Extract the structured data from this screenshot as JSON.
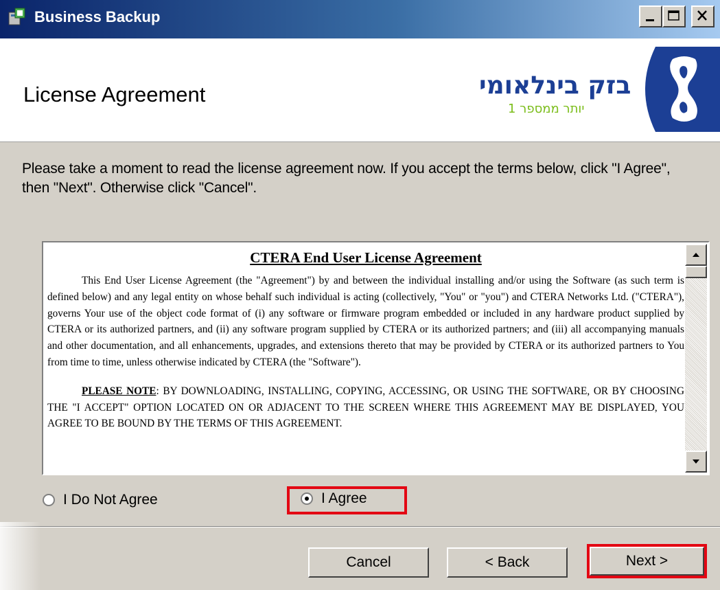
{
  "window": {
    "title": "Business Backup",
    "controls": {
      "minimize": "minimize",
      "maximize": "maximize",
      "close": "close"
    }
  },
  "header": {
    "title": "License Agreement",
    "logo_main": "בזק בינלאומי",
    "logo_sub": "יותר ממספר 1"
  },
  "intro": "Please take a moment to read the license agreement now. If you accept the terms below, click \"I Agree\", then \"Next\". Otherwise click \"Cancel\".",
  "license": {
    "title": "CTERA End User License Agreement",
    "para1": "This End User License Agreement (the \"Agreement\") by and between the individual installing and/or using the Software (as such term is defined below) and any legal entity on whose behalf such individual is acting (collectively, \"You\" or \"you\") and CTERA Networks Ltd. (\"CTERA\"), governs Your use of the object code format of (i) any software or firmware program embedded or included in any hardware product supplied by CTERA or its authorized partners, and (ii) any software program supplied by CTERA or its authorized partners; and (iii) all accompanying manuals and other documentation, and all enhancements, upgrades, and extensions thereto that may be provided by CTERA or its authorized partners to You from time to time, unless otherwise indicated by CTERA (the \"Software\").",
    "para2_label": "PLEASE NOTE",
    "para2": ": BY DOWNLOADING, INSTALLING, COPYING, ACCESSING, OR USING THE SOFTWARE, OR BY CHOOSING THE \"I ACCEPT\" OPTION LOCATED ON OR ADJACENT TO THE SCREEN WHERE THIS AGREEMENT MAY BE DISPLAYED, YOU AGREE TO BE BOUND BY THE TERMS OF THIS AGREEMENT."
  },
  "options": {
    "disagree_label": "I Do Not Agree",
    "agree_label": "I Agree",
    "selected": "agree"
  },
  "buttons": {
    "cancel": "Cancel",
    "back": "< Back",
    "next": "Next >"
  },
  "colors": {
    "highlight": "#e30613",
    "logo_blue": "#1c3f95",
    "logo_green": "#7bbd1a"
  }
}
